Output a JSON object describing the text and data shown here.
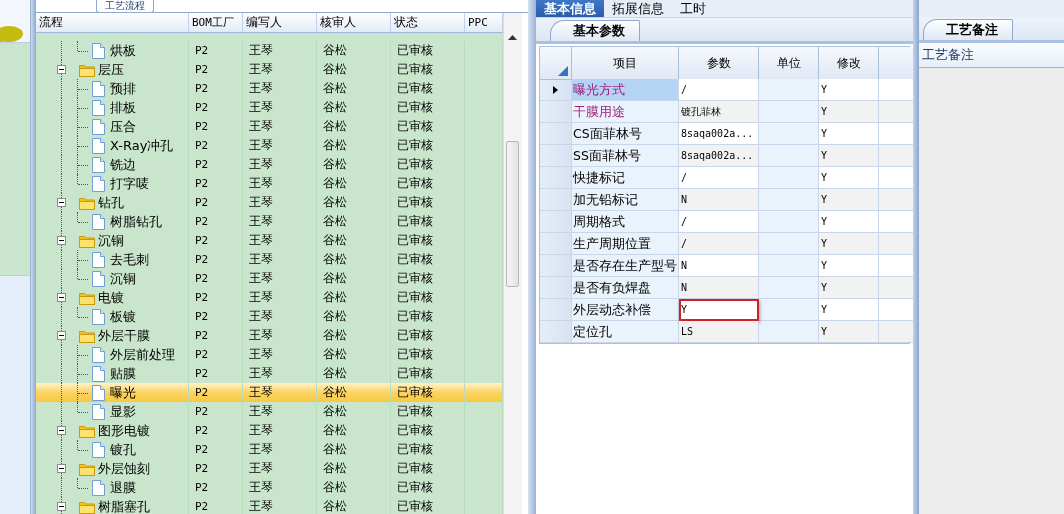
{
  "process_tab": {
    "label": "工艺流程"
  },
  "tree": {
    "columns": [
      "流程",
      "BOM工厂",
      "编写人",
      "核审人",
      "状态",
      "PPC"
    ],
    "leading": [
      {
        "name": "烘板",
        "factory": "P2",
        "author": "王琴",
        "reviewer": "谷松",
        "status": "已审核",
        "selected": false
      }
    ],
    "groups": [
      {
        "name": "层压",
        "factory": "P2",
        "author": "王琴",
        "reviewer": "谷松",
        "status": "已审核",
        "selected": false,
        "expanded": true,
        "children": [
          {
            "name": "预排",
            "factory": "P2",
            "author": "王琴",
            "reviewer": "谷松",
            "status": "已审核",
            "selected": false
          },
          {
            "name": "排板",
            "factory": "P2",
            "author": "王琴",
            "reviewer": "谷松",
            "status": "已审核",
            "selected": false
          },
          {
            "name": "压合",
            "factory": "P2",
            "author": "王琴",
            "reviewer": "谷松",
            "status": "已审核",
            "selected": false
          },
          {
            "name": "X-Ray冲孔",
            "factory": "P2",
            "author": "王琴",
            "reviewer": "谷松",
            "status": "已审核",
            "selected": false
          },
          {
            "name": "铣边",
            "factory": "P2",
            "author": "王琴",
            "reviewer": "谷松",
            "status": "已审核",
            "selected": false
          },
          {
            "name": "打字唛",
            "factory": "P2",
            "author": "王琴",
            "reviewer": "谷松",
            "status": "已审核",
            "selected": false
          }
        ]
      },
      {
        "name": "钻孔",
        "factory": "P2",
        "author": "王琴",
        "reviewer": "谷松",
        "status": "已审核",
        "selected": false,
        "expanded": true,
        "children": [
          {
            "name": "树脂钻孔",
            "factory": "P2",
            "author": "王琴",
            "reviewer": "谷松",
            "status": "已审核",
            "selected": false
          }
        ]
      },
      {
        "name": "沉铜",
        "factory": "P2",
        "author": "王琴",
        "reviewer": "谷松",
        "status": "已审核",
        "selected": false,
        "expanded": true,
        "children": [
          {
            "name": "去毛刺",
            "factory": "P2",
            "author": "王琴",
            "reviewer": "谷松",
            "status": "已审核",
            "selected": false
          },
          {
            "name": "沉铜",
            "factory": "P2",
            "author": "王琴",
            "reviewer": "谷松",
            "status": "已审核",
            "selected": false
          }
        ]
      },
      {
        "name": "电镀",
        "factory": "P2",
        "author": "王琴",
        "reviewer": "谷松",
        "status": "已审核",
        "selected": false,
        "expanded": true,
        "children": [
          {
            "name": "板镀",
            "factory": "P2",
            "author": "王琴",
            "reviewer": "谷松",
            "status": "已审核",
            "selected": false
          }
        ]
      },
      {
        "name": "外层干膜",
        "factory": "P2",
        "author": "王琴",
        "reviewer": "谷松",
        "status": "已审核",
        "selected": false,
        "expanded": true,
        "children": [
          {
            "name": "外层前处理",
            "factory": "P2",
            "author": "王琴",
            "reviewer": "谷松",
            "status": "已审核",
            "selected": false
          },
          {
            "name": "贴膜",
            "factory": "P2",
            "author": "王琴",
            "reviewer": "谷松",
            "status": "已审核",
            "selected": false
          },
          {
            "name": "曝光",
            "factory": "P2",
            "author": "王琴",
            "reviewer": "谷松",
            "status": "已审核",
            "selected": true
          },
          {
            "name": "显影",
            "factory": "P2",
            "author": "王琴",
            "reviewer": "谷松",
            "status": "已审核",
            "selected": false
          }
        ]
      },
      {
        "name": "图形电镀",
        "factory": "P2",
        "author": "王琴",
        "reviewer": "谷松",
        "status": "已审核",
        "selected": false,
        "expanded": true,
        "children": [
          {
            "name": "镀孔",
            "factory": "P2",
            "author": "王琴",
            "reviewer": "谷松",
            "status": "已审核",
            "selected": false
          }
        ]
      },
      {
        "name": "外层蚀刻",
        "factory": "P2",
        "author": "王琴",
        "reviewer": "谷松",
        "status": "已审核",
        "selected": false,
        "expanded": true,
        "children": [
          {
            "name": "退膜",
            "factory": "P2",
            "author": "王琴",
            "reviewer": "谷松",
            "status": "已审核",
            "selected": false
          }
        ]
      },
      {
        "name": "树脂塞孔",
        "factory": "P2",
        "author": "王琴",
        "reviewer": "谷松",
        "status": "已审核",
        "selected": false,
        "expanded": true
      }
    ]
  },
  "info_tabs": [
    {
      "label": "基本信息",
      "selected": true
    },
    {
      "label": "拓展信息",
      "selected": false
    },
    {
      "label": "工时",
      "selected": false
    }
  ],
  "params_tab": {
    "label": "基本参数"
  },
  "params": {
    "columns": [
      "项目",
      "参数",
      "单位",
      "修改"
    ],
    "rows": [
      {
        "item": "曝光方式",
        "value": "/",
        "modified": "Y",
        "required": true,
        "selected": true,
        "highlighted": false
      },
      {
        "item": "干膜用途",
        "value": "镀孔菲林",
        "modified": "Y",
        "required": true,
        "selected": false,
        "highlighted": false
      },
      {
        "item": "CS面菲林号",
        "value": "8saqa002a...",
        "modified": "Y",
        "required": false,
        "selected": false,
        "highlighted": false
      },
      {
        "item": "SS面菲林号",
        "value": "8saqa002a...",
        "modified": "Y",
        "required": false,
        "selected": false,
        "highlighted": false
      },
      {
        "item": "快捷标记",
        "value": "/",
        "modified": "Y",
        "required": false,
        "selected": false,
        "highlighted": false
      },
      {
        "item": "加无铅标记",
        "value": "N",
        "modified": "Y",
        "required": false,
        "selected": false,
        "highlighted": false
      },
      {
        "item": "周期格式",
        "value": "/",
        "modified": "Y",
        "required": false,
        "selected": false,
        "highlighted": false
      },
      {
        "item": "生产周期位置",
        "value": "/",
        "modified": "Y",
        "required": false,
        "selected": false,
        "highlighted": false
      },
      {
        "item": "是否存在生产型号",
        "value": "N",
        "modified": "Y",
        "required": false,
        "selected": false,
        "highlighted": false
      },
      {
        "item": "是否有负焊盘",
        "value": "N",
        "modified": "Y",
        "required": false,
        "selected": false,
        "highlighted": false
      },
      {
        "item": "外层动态补偿",
        "value": "Y",
        "modified": "Y",
        "required": false,
        "selected": false,
        "highlighted": true
      },
      {
        "item": "定位孔",
        "value": "LS",
        "modified": "Y",
        "required": false,
        "selected": false,
        "highlighted": false
      }
    ]
  },
  "notes_tab": {
    "label": "工艺备注"
  },
  "notes": {
    "header": "工艺备注"
  }
}
